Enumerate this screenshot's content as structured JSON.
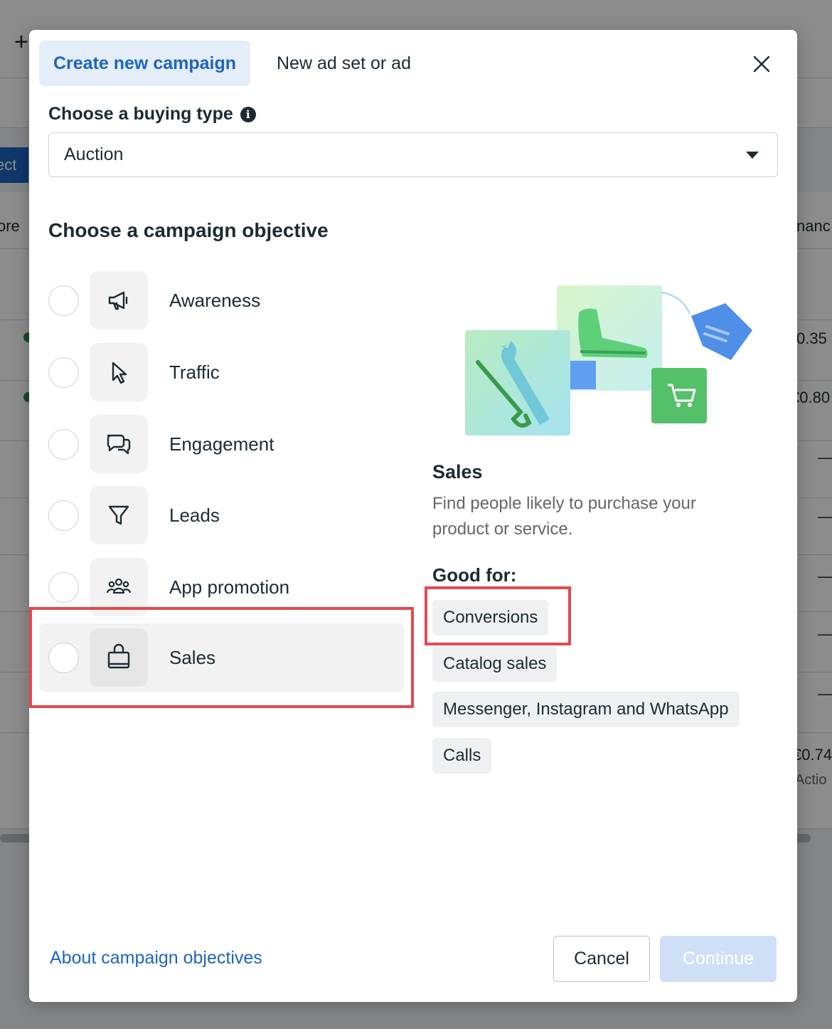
{
  "background": {
    "select_fragment": "ect",
    "more_fragment": "ore",
    "column_fragment": "nanc",
    "values": [
      "0.35",
      "€0.80",
      "—",
      "—",
      "—",
      "—",
      "—",
      "€0.74"
    ],
    "action_fragment": "Actio",
    "sort_icon": "sort-icon"
  },
  "modal": {
    "tabs": {
      "active": "Create new campaign",
      "inactive": "New ad set or ad"
    },
    "close_icon": "close-icon",
    "buying_type": {
      "label": "Choose a buying type",
      "info_icon": "i",
      "selected": "Auction"
    },
    "objective": {
      "label": "Choose a campaign objective",
      "options": [
        {
          "label": "Awareness",
          "icon": "megaphone-icon"
        },
        {
          "label": "Traffic",
          "icon": "cursor-icon"
        },
        {
          "label": "Engagement",
          "icon": "chat-bubbles-icon"
        },
        {
          "label": "Leads",
          "icon": "funnel-icon"
        },
        {
          "label": "App promotion",
          "icon": "people-group-icon"
        },
        {
          "label": "Sales",
          "icon": "shopping-bag-icon"
        }
      ],
      "selected": "Sales"
    },
    "detail": {
      "title": "Sales",
      "description": "Find people likely to purchase your product or service.",
      "good_for_label": "Good for:",
      "good_for": [
        "Conversions",
        "Catalog sales",
        "Messenger, Instagram and WhatsApp",
        "Calls"
      ]
    },
    "footer": {
      "about_link": "About campaign objectives",
      "cancel": "Cancel",
      "continue": "Continue"
    },
    "colors": {
      "accent": "#1d65c1",
      "highlight": "#e5484d",
      "continue_disabled": "#cfe0f6"
    }
  }
}
